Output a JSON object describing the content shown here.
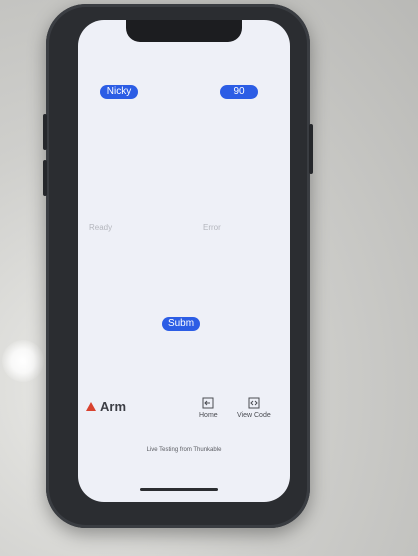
{
  "app": {
    "name": "Arm"
  },
  "fields": {
    "name_value": "Nicky",
    "number_value": "90"
  },
  "labels": {
    "ready": "Ready",
    "error": "Error"
  },
  "buttons": {
    "submit": "Subm"
  },
  "nav": {
    "home": "Home",
    "view_code": "View Code"
  },
  "footer": {
    "text": "Live Testing from Thunkable"
  },
  "icons": {
    "brand": "thunkable-logo-icon",
    "home": "home-icon",
    "view_code": "code-icon"
  },
  "colors": {
    "accent": "#2c5de5",
    "brand": "#d8422f",
    "screen_bg": "#eef0f7",
    "phone_case": "#2b2d31"
  }
}
